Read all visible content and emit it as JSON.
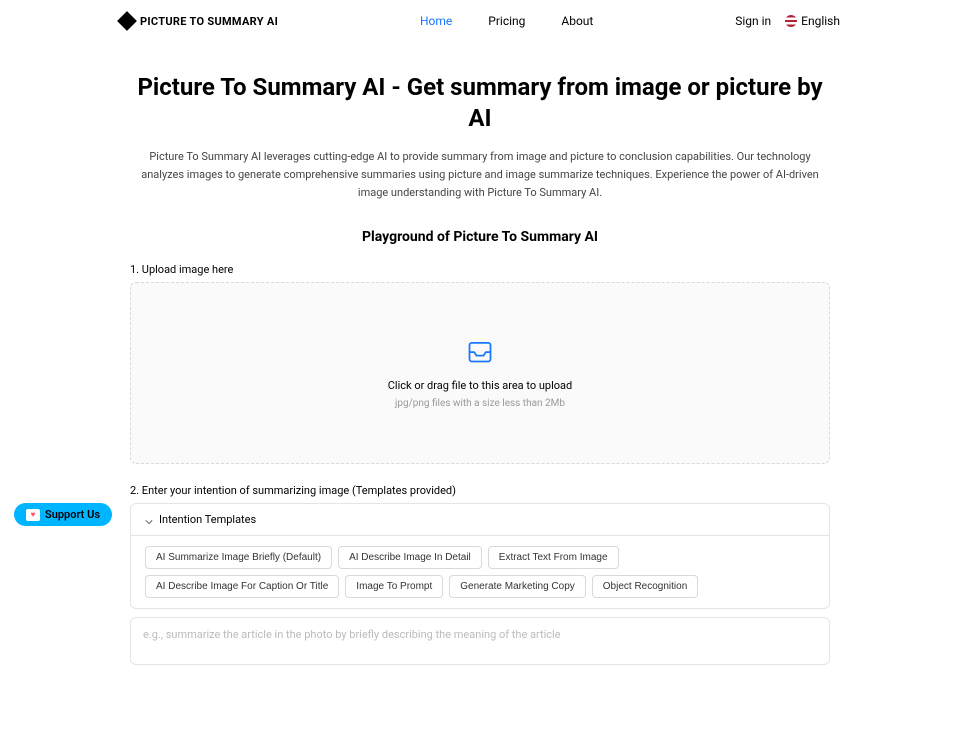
{
  "header": {
    "logo_text": "PICTURE TO SUMMARY AI",
    "nav": [
      {
        "label": "Home",
        "active": true
      },
      {
        "label": "Pricing",
        "active": false
      },
      {
        "label": "About",
        "active": false
      }
    ],
    "signin": "Sign in",
    "language": "English"
  },
  "hero": {
    "title": "Picture To Summary AI - Get summary from image or picture by AI",
    "lead": "Picture To Summary AI leverages cutting-edge AI to provide summary from image and picture to conclusion capabilities. Our technology analyzes images to generate comprehensive summaries using picture and image summarize techniques. Experience the power of AI-driven image understanding with Picture To Summary AI."
  },
  "playground": {
    "heading": "Playground of Picture To Summary AI",
    "step1_label": "1. Upload image here",
    "upload": {
      "text": "Click or drag file to this area to upload",
      "hint": "jpg/png files with a size less than 2Mb"
    },
    "step2_label": "2. Enter your intention of summarizing image (Templates provided)",
    "templates_header": "Intention Templates",
    "templates": [
      "AI Summarize Image Briefly (Default)",
      "AI Describe Image In Detail",
      "Extract Text From Image",
      "AI Describe Image For Caption Or Title",
      "Image To Prompt",
      "Generate Marketing Copy",
      "Object Recognition"
    ],
    "intention_placeholder": "e.g., summarize the article in the photo by briefly describing the meaning of the article"
  },
  "support": {
    "label": "Support Us"
  }
}
